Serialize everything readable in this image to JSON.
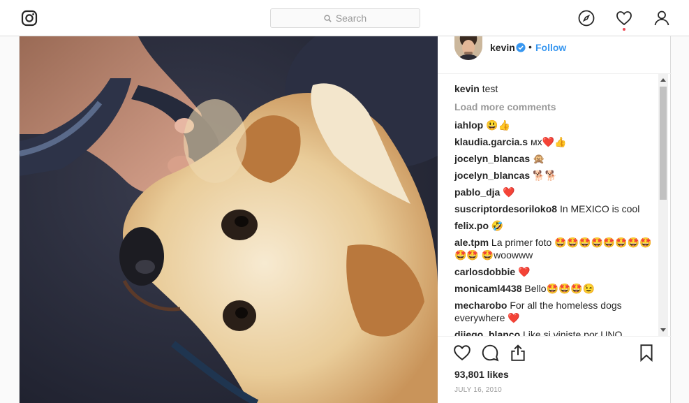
{
  "search": {
    "placeholder": "Search"
  },
  "post": {
    "username": "kevin",
    "separator": "•",
    "follow_label": "Follow",
    "caption_user": "kevin",
    "caption_text": "test",
    "load_more": "Load more comments",
    "comments": [
      {
        "user": "iahlop",
        "text": "😃👍"
      },
      {
        "user": "klaudia.garcia.s",
        "text": "ᴍx❤️👍"
      },
      {
        "user": "jocelyn_blancas",
        "text": "🙊"
      },
      {
        "user": "jocelyn_blancas",
        "text": "🐕🐕"
      },
      {
        "user": "pablo_dja",
        "text": "❤️"
      },
      {
        "user": "suscriptordesoriloko8",
        "text": "In MEXICO is cool"
      },
      {
        "user": "felix.po",
        "text": "🤣"
      },
      {
        "user": "ale.tpm",
        "text": "La primer foto 🤩🤩🤩🤩🤩🤩🤩🤩🤩🤩 🤩woowww"
      },
      {
        "user": "carlosdobbie",
        "text": "❤️"
      },
      {
        "user": "monicaml4438",
        "text": "Bello🤩🤩🤩😉"
      },
      {
        "user": "mecharobo",
        "text": "For all the homeless dogs everywhere ❤️"
      },
      {
        "user": "diiego_blanco",
        "text": "Like si viniste por UNO"
      }
    ],
    "likes": "93,801 likes",
    "date": "JULY 16, 2010"
  },
  "colors": {
    "accent": "#3897f0",
    "notification": "#ed4956",
    "heart": "#e0245e"
  },
  "icons": [
    "instagram-logo-icon",
    "search-icon",
    "explore-compass-icon",
    "activity-heart-icon",
    "profile-icon",
    "verified-badge-icon",
    "like-heart-icon",
    "comment-icon",
    "share-icon",
    "bookmark-icon"
  ]
}
